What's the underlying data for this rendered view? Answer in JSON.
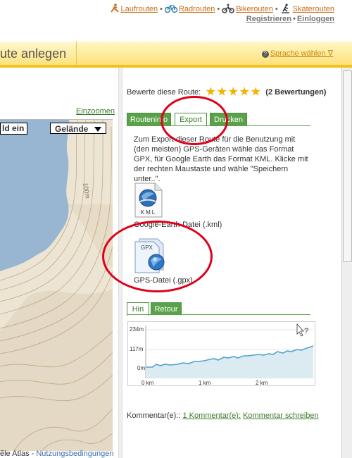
{
  "nav": {
    "links": [
      {
        "label": "Laufrouten"
      },
      {
        "label": "Radrouten"
      },
      {
        "label": "Bikerouten"
      },
      {
        "label": "Skaterouten"
      }
    ],
    "register": "Registrieren",
    "login": "Einloggen",
    "separator": "•"
  },
  "header": {
    "title_fragment": "ute anlegen",
    "language": "Sprache wählen ∇"
  },
  "map": {
    "zoom": "Einzoomen",
    "button_fragment": "ld ein",
    "terrain": "Gelände",
    "contour_label": "100m",
    "footer_fragment": "ẽle Atlas - ",
    "footer_link": "Nutzungsbedingungen"
  },
  "rating": {
    "label": "Bewerte diese Route:",
    "stars": 5,
    "count": "(2 Bewertungen)"
  },
  "tabs": {
    "routeinfo": "Routeninfo",
    "export": "Export",
    "print": "Drucken"
  },
  "export": {
    "text": "Zum Export dieser Route für die Benutzung mit (den meisten) GPS-Geräten wähle das Format GPX, für Google Earth das Format KML. Klicke mit der rechten Maustaste und wähle \"Speichern unter..\".",
    "kml_badge": "KML",
    "kml_label": "Google-Earth-Datei (.kml)",
    "gpx_badge": "GPX",
    "gpx_label": "GPS-Datei (.gpx)"
  },
  "profile_tabs": {
    "hin": "Hin",
    "retour": "Retour"
  },
  "profile": {
    "y_labels": [
      "234m",
      "117m",
      "0m"
    ],
    "x_labels": [
      "0 km",
      "1 km",
      "2 km"
    ],
    "help_glyph": "?"
  },
  "comment": {
    "label": "Kommentar(e):: ",
    "link": "1 Kommentar(e):",
    "write": "Kommentar schreiben"
  }
}
